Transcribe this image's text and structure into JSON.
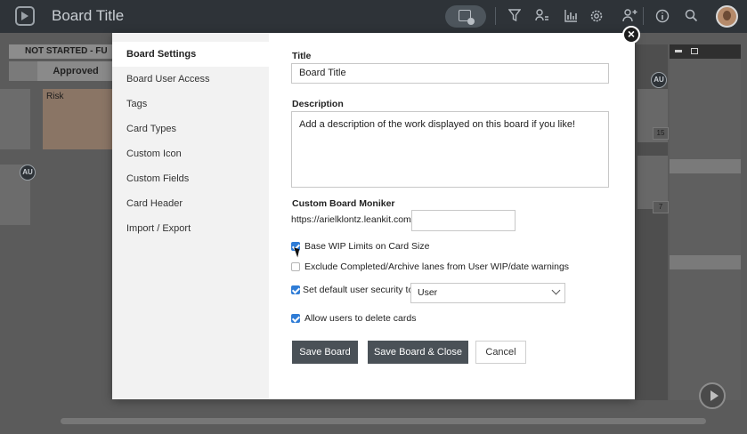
{
  "app": {
    "board_title": "Board Title"
  },
  "background": {
    "lane_header": "NOT STARTED - FU",
    "lane_column": "Approved",
    "card_label": "Risk",
    "avatar_initials": "AU",
    "wip_counts": [
      "15",
      "7"
    ]
  },
  "modal": {
    "nav": [
      {
        "label": "Board Settings",
        "active": true
      },
      {
        "label": "Board User Access"
      },
      {
        "label": "Tags"
      },
      {
        "label": "Card Types"
      },
      {
        "label": "Custom Icon"
      },
      {
        "label": "Custom Fields"
      },
      {
        "label": "Card Header"
      },
      {
        "label": "Import / Export"
      }
    ],
    "close_symbol": "×",
    "form": {
      "title_label": "Title",
      "title_value": "Board Title",
      "description_label": "Description",
      "description_value": "Add a description of the work displayed on this board if you like!",
      "moniker_label": "Custom Board Moniker",
      "moniker_prefix": "https://arielklontz.leankit.com/",
      "moniker_value": "",
      "checkboxes": [
        {
          "label": "Base WIP Limits on Card Size",
          "checked": true
        },
        {
          "label": "Exclude Completed/Archive lanes from User WIP/date warnings",
          "checked": false
        },
        {
          "label": "Set default user security to",
          "checked": true
        },
        {
          "label": "Allow users to delete cards",
          "checked": true
        }
      ],
      "security_select_value": "User",
      "buttons": {
        "save": "Save Board",
        "save_close": "Save Board & Close",
        "cancel": "Cancel"
      }
    }
  },
  "colors": {
    "accent": "#2f7cd6",
    "button": "#4a5157",
    "topbar": "#2e3338"
  }
}
